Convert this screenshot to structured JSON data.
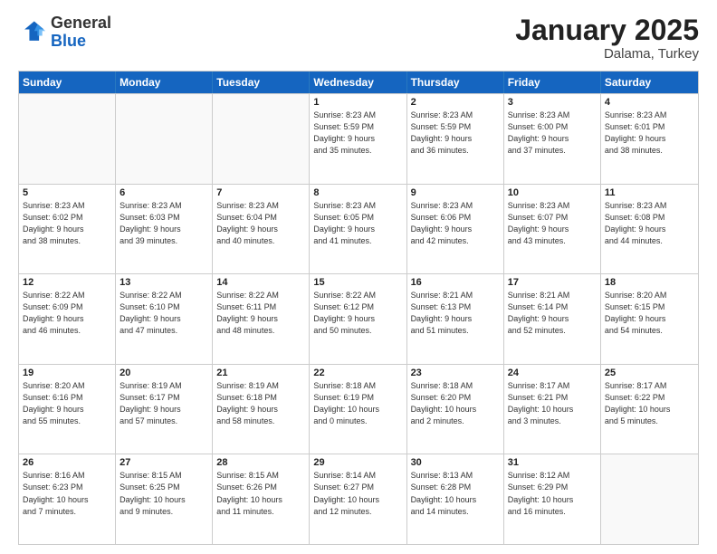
{
  "logo": {
    "general": "General",
    "blue": "Blue"
  },
  "header": {
    "month": "January 2025",
    "location": "Dalama, Turkey"
  },
  "days_of_week": [
    "Sunday",
    "Monday",
    "Tuesday",
    "Wednesday",
    "Thursday",
    "Friday",
    "Saturday"
  ],
  "weeks": [
    [
      {
        "day": "",
        "info": ""
      },
      {
        "day": "",
        "info": ""
      },
      {
        "day": "",
        "info": ""
      },
      {
        "day": "1",
        "info": "Sunrise: 8:23 AM\nSunset: 5:59 PM\nDaylight: 9 hours\nand 35 minutes."
      },
      {
        "day": "2",
        "info": "Sunrise: 8:23 AM\nSunset: 5:59 PM\nDaylight: 9 hours\nand 36 minutes."
      },
      {
        "day": "3",
        "info": "Sunrise: 8:23 AM\nSunset: 6:00 PM\nDaylight: 9 hours\nand 37 minutes."
      },
      {
        "day": "4",
        "info": "Sunrise: 8:23 AM\nSunset: 6:01 PM\nDaylight: 9 hours\nand 38 minutes."
      }
    ],
    [
      {
        "day": "5",
        "info": "Sunrise: 8:23 AM\nSunset: 6:02 PM\nDaylight: 9 hours\nand 38 minutes."
      },
      {
        "day": "6",
        "info": "Sunrise: 8:23 AM\nSunset: 6:03 PM\nDaylight: 9 hours\nand 39 minutes."
      },
      {
        "day": "7",
        "info": "Sunrise: 8:23 AM\nSunset: 6:04 PM\nDaylight: 9 hours\nand 40 minutes."
      },
      {
        "day": "8",
        "info": "Sunrise: 8:23 AM\nSunset: 6:05 PM\nDaylight: 9 hours\nand 41 minutes."
      },
      {
        "day": "9",
        "info": "Sunrise: 8:23 AM\nSunset: 6:06 PM\nDaylight: 9 hours\nand 42 minutes."
      },
      {
        "day": "10",
        "info": "Sunrise: 8:23 AM\nSunset: 6:07 PM\nDaylight: 9 hours\nand 43 minutes."
      },
      {
        "day": "11",
        "info": "Sunrise: 8:23 AM\nSunset: 6:08 PM\nDaylight: 9 hours\nand 44 minutes."
      }
    ],
    [
      {
        "day": "12",
        "info": "Sunrise: 8:22 AM\nSunset: 6:09 PM\nDaylight: 9 hours\nand 46 minutes."
      },
      {
        "day": "13",
        "info": "Sunrise: 8:22 AM\nSunset: 6:10 PM\nDaylight: 9 hours\nand 47 minutes."
      },
      {
        "day": "14",
        "info": "Sunrise: 8:22 AM\nSunset: 6:11 PM\nDaylight: 9 hours\nand 48 minutes."
      },
      {
        "day": "15",
        "info": "Sunrise: 8:22 AM\nSunset: 6:12 PM\nDaylight: 9 hours\nand 50 minutes."
      },
      {
        "day": "16",
        "info": "Sunrise: 8:21 AM\nSunset: 6:13 PM\nDaylight: 9 hours\nand 51 minutes."
      },
      {
        "day": "17",
        "info": "Sunrise: 8:21 AM\nSunset: 6:14 PM\nDaylight: 9 hours\nand 52 minutes."
      },
      {
        "day": "18",
        "info": "Sunrise: 8:20 AM\nSunset: 6:15 PM\nDaylight: 9 hours\nand 54 minutes."
      }
    ],
    [
      {
        "day": "19",
        "info": "Sunrise: 8:20 AM\nSunset: 6:16 PM\nDaylight: 9 hours\nand 55 minutes."
      },
      {
        "day": "20",
        "info": "Sunrise: 8:19 AM\nSunset: 6:17 PM\nDaylight: 9 hours\nand 57 minutes."
      },
      {
        "day": "21",
        "info": "Sunrise: 8:19 AM\nSunset: 6:18 PM\nDaylight: 9 hours\nand 58 minutes."
      },
      {
        "day": "22",
        "info": "Sunrise: 8:18 AM\nSunset: 6:19 PM\nDaylight: 10 hours\nand 0 minutes."
      },
      {
        "day": "23",
        "info": "Sunrise: 8:18 AM\nSunset: 6:20 PM\nDaylight: 10 hours\nand 2 minutes."
      },
      {
        "day": "24",
        "info": "Sunrise: 8:17 AM\nSunset: 6:21 PM\nDaylight: 10 hours\nand 3 minutes."
      },
      {
        "day": "25",
        "info": "Sunrise: 8:17 AM\nSunset: 6:22 PM\nDaylight: 10 hours\nand 5 minutes."
      }
    ],
    [
      {
        "day": "26",
        "info": "Sunrise: 8:16 AM\nSunset: 6:23 PM\nDaylight: 10 hours\nand 7 minutes."
      },
      {
        "day": "27",
        "info": "Sunrise: 8:15 AM\nSunset: 6:25 PM\nDaylight: 10 hours\nand 9 minutes."
      },
      {
        "day": "28",
        "info": "Sunrise: 8:15 AM\nSunset: 6:26 PM\nDaylight: 10 hours\nand 11 minutes."
      },
      {
        "day": "29",
        "info": "Sunrise: 8:14 AM\nSunset: 6:27 PM\nDaylight: 10 hours\nand 12 minutes."
      },
      {
        "day": "30",
        "info": "Sunrise: 8:13 AM\nSunset: 6:28 PM\nDaylight: 10 hours\nand 14 minutes."
      },
      {
        "day": "31",
        "info": "Sunrise: 8:12 AM\nSunset: 6:29 PM\nDaylight: 10 hours\nand 16 minutes."
      },
      {
        "day": "",
        "info": ""
      }
    ]
  ]
}
